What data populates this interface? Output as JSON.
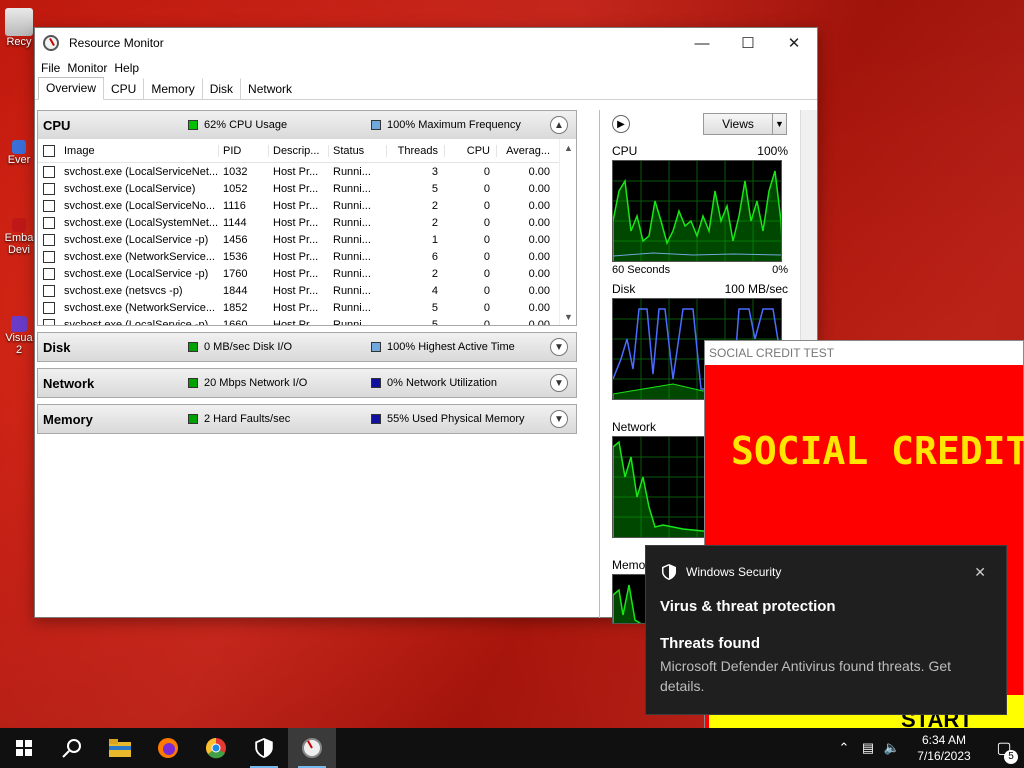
{
  "desktop": {
    "icons": [
      {
        "label": "Recy"
      },
      {
        "label": "Ever"
      },
      {
        "label": "Emba Devi"
      },
      {
        "label": "Visua 2"
      }
    ]
  },
  "resource_monitor": {
    "title": "Resource Monitor",
    "menu": [
      "File",
      "Monitor",
      "Help"
    ],
    "tabs": [
      "Overview",
      "CPU",
      "Memory",
      "Disk",
      "Network"
    ],
    "active_tab": "Overview",
    "cpu": {
      "name": "CPU",
      "usage_label": "62% CPU Usage",
      "freq_label": "100% Maximum Frequency",
      "columns": [
        "Image",
        "PID",
        "Descrip...",
        "Status",
        "Threads",
        "CPU",
        "Averag..."
      ],
      "rows": [
        {
          "image": "svchost.exe (LocalServiceNet...",
          "pid": "1032",
          "desc": "Host Pr...",
          "status": "Runni...",
          "threads": "3",
          "cpu": "0",
          "avg": "0.00"
        },
        {
          "image": "svchost.exe (LocalService)",
          "pid": "1052",
          "desc": "Host Pr...",
          "status": "Runni...",
          "threads": "5",
          "cpu": "0",
          "avg": "0.00"
        },
        {
          "image": "svchost.exe (LocalServiceNo...",
          "pid": "1116",
          "desc": "Host Pr...",
          "status": "Runni...",
          "threads": "2",
          "cpu": "0",
          "avg": "0.00"
        },
        {
          "image": "svchost.exe (LocalSystemNet...",
          "pid": "1144",
          "desc": "Host Pr...",
          "status": "Runni...",
          "threads": "2",
          "cpu": "0",
          "avg": "0.00"
        },
        {
          "image": "svchost.exe (LocalService -p)",
          "pid": "1456",
          "desc": "Host Pr...",
          "status": "Runni...",
          "threads": "1",
          "cpu": "0",
          "avg": "0.00"
        },
        {
          "image": "svchost.exe (NetworkService...",
          "pid": "1536",
          "desc": "Host Pr...",
          "status": "Runni...",
          "threads": "6",
          "cpu": "0",
          "avg": "0.00"
        },
        {
          "image": "svchost.exe (LocalService -p)",
          "pid": "1760",
          "desc": "Host Pr...",
          "status": "Runni...",
          "threads": "2",
          "cpu": "0",
          "avg": "0.00"
        },
        {
          "image": "svchost.exe (netsvcs -p)",
          "pid": "1844",
          "desc": "Host Pr...",
          "status": "Runni...",
          "threads": "4",
          "cpu": "0",
          "avg": "0.00"
        },
        {
          "image": "svchost.exe (NetworkService...",
          "pid": "1852",
          "desc": "Host Pr...",
          "status": "Runni...",
          "threads": "5",
          "cpu": "0",
          "avg": "0.00"
        },
        {
          "image": "svchost.exe (LocalService -p)",
          "pid": "1660",
          "desc": "Host Pr...",
          "status": "Runni...",
          "threads": "5",
          "cpu": "0",
          "avg": "0.00"
        }
      ]
    },
    "disk": {
      "name": "Disk",
      "io_label": "0 MB/sec Disk I/O",
      "active_label": "100% Highest Active Time"
    },
    "network": {
      "name": "Network",
      "io_label": "20 Mbps Network I/O",
      "util_label": "0% Network Utilization"
    },
    "memory": {
      "name": "Memory",
      "faults_label": "2 Hard Faults/sec",
      "used_label": "55% Used Physical Memory"
    },
    "graphs": {
      "views_label": "Views",
      "cpu": {
        "title": "CPU",
        "max": "100%",
        "foot_left": "60 Seconds",
        "foot_right": "0%"
      },
      "disk": {
        "title": "Disk",
        "max": "100 MB/sec"
      },
      "network": {
        "title": "Network"
      },
      "memory": {
        "title": "Memo"
      }
    },
    "colors": {
      "green": "#00b000",
      "blue_light": "#6fa8dc",
      "blue_dark": "#1010a0"
    }
  },
  "social_credit": {
    "window_title": "SOCIAL CREDIT TEST",
    "headline": "SOCIAL CREDIT",
    "start_label": "START"
  },
  "toast": {
    "app": "Windows Security",
    "title": "Virus & threat protection",
    "subtitle": "Threats found",
    "body": "Microsoft Defender Antivirus found threats. Get details."
  },
  "taskbar": {
    "time": "6:34 AM",
    "date": "7/16/2023",
    "notification_count": "5"
  }
}
